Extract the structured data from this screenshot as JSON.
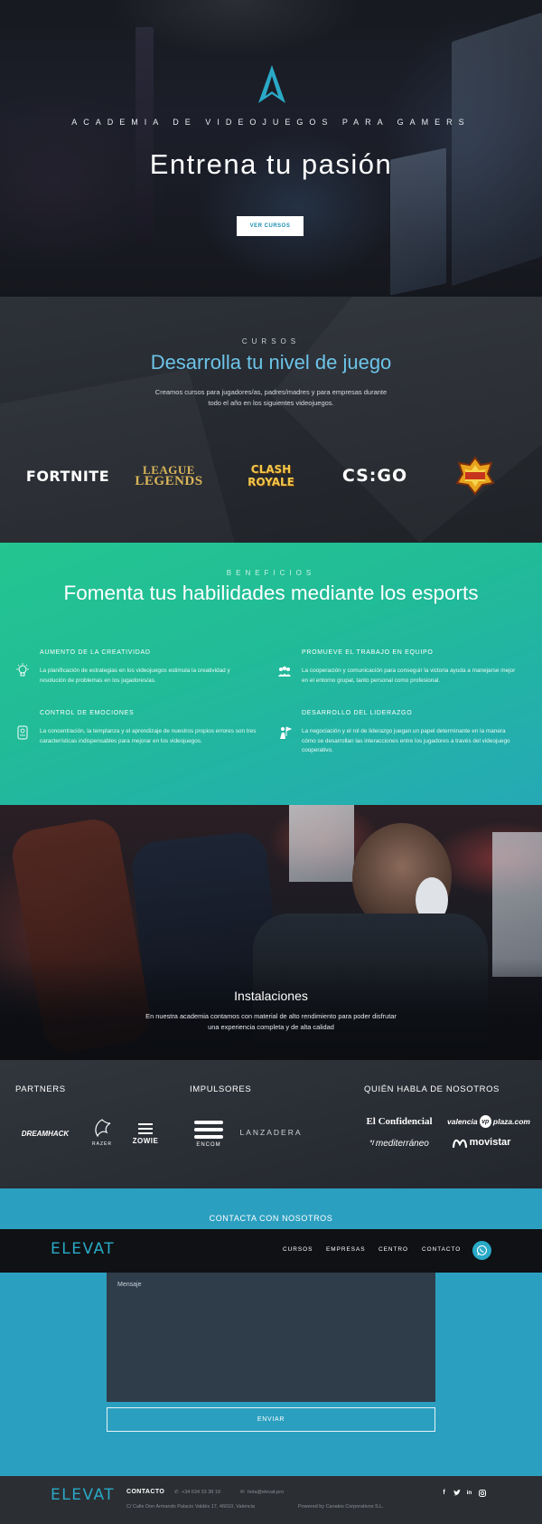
{
  "hero": {
    "kicker": "ACADEMIA DE VIDEOJUEGOS PARA GAMERS",
    "title": "Entrena tu pasión",
    "button": "VER CURSOS"
  },
  "cursos": {
    "kicker": "CURSOS",
    "title": "Desarrolla tu nivel de juego",
    "desc_line1": "Creamos cursos para jugadores/as, padres/madres y para empresas durante",
    "desc_line2": "todo el año en los siguientes videojuegos.",
    "games": {
      "fortnite": "FORTNITE",
      "lol_1": "LEAGUE",
      "lol_2": "LEGENDS",
      "clash_1": "CLASH",
      "clash_2": "ROYALE",
      "csgo": "CS:GO",
      "brawl": "BRAWL STARS"
    }
  },
  "beneficios": {
    "kicker": "BENEFICIOS",
    "title": "Fomenta tus habilidades mediante los esports",
    "items": [
      {
        "title": "AUMENTO DE LA CREATIVIDAD",
        "text": "La planificación de estrategias en los videojuegos estimula la creatividad y resolución de problemas en los jugadores/as."
      },
      {
        "title": "PROMUEVE EL TRABAJO EN EQUIPO",
        "text": "La cooperación y comunicación para conseguir la victoria ayuda a manejarse mejor en el entorno grupal, tanto personal como profesional."
      },
      {
        "title": "CONTROL DE EMOCIONES",
        "text": "La concentración, la templanza y el aprendizaje de nuestros propios errores son tres características indispensables para mejorar en los videojuegos."
      },
      {
        "title": "DESARROLLO DEL LIDERAZGO",
        "text": "La negociación y el rol de liderazgo juegan un papel determinante en la manera cómo se desarrollan las interacciones entre los jugadores a través del videojuego cooperativo."
      }
    ]
  },
  "instalaciones": {
    "title": "Instalaciones",
    "desc_line1": "En nuestra academia contamos con material de alto rendimiento para poder disfrutar",
    "desc_line2": "una experiencia completa y de alta calidad"
  },
  "partners": {
    "partners_h": "PARTNERS",
    "impulsores_h": "IMPULSORES",
    "prensa_h": "QUIÉN HABLA DE NOSOTROS",
    "logos": {
      "dreamhack": "DREAMHACK",
      "razer": "RAZER",
      "zowie": "ZOWIE",
      "encom": "ENCOM",
      "lanzadera": "LANZADERA",
      "confidencial": "El Confidencial",
      "valencia_a": "valencia",
      "valencia_b": "vp",
      "valencia_c": "plaza.com",
      "mediterraneo": "mediterráneo",
      "movistar": "movistar"
    }
  },
  "contacta": {
    "title": "CONTACTA CON NOSOTROS",
    "message_placeholder": "Mensaje",
    "send": "ENVIAR"
  },
  "nav": {
    "logo": "ELEVAT",
    "items": [
      "CURSOS",
      "EMPRESAS",
      "CENTRO",
      "CONTACTO"
    ]
  },
  "footer": {
    "logo": "ELEVAT",
    "contact_label": "CONTACTO",
    "phone": "+34 634 33 38 19",
    "email": "hola@elevat.pro",
    "address": "C/ Calle Don Armando Palacio Valdés 17, 46010, Valencia",
    "powered": "Powered by Canales Corporativos S.L."
  },
  "colors": {
    "accent": "#2aa9c7",
    "benefits_green": "#24c590",
    "contact_blue": "#2b9fc0"
  }
}
